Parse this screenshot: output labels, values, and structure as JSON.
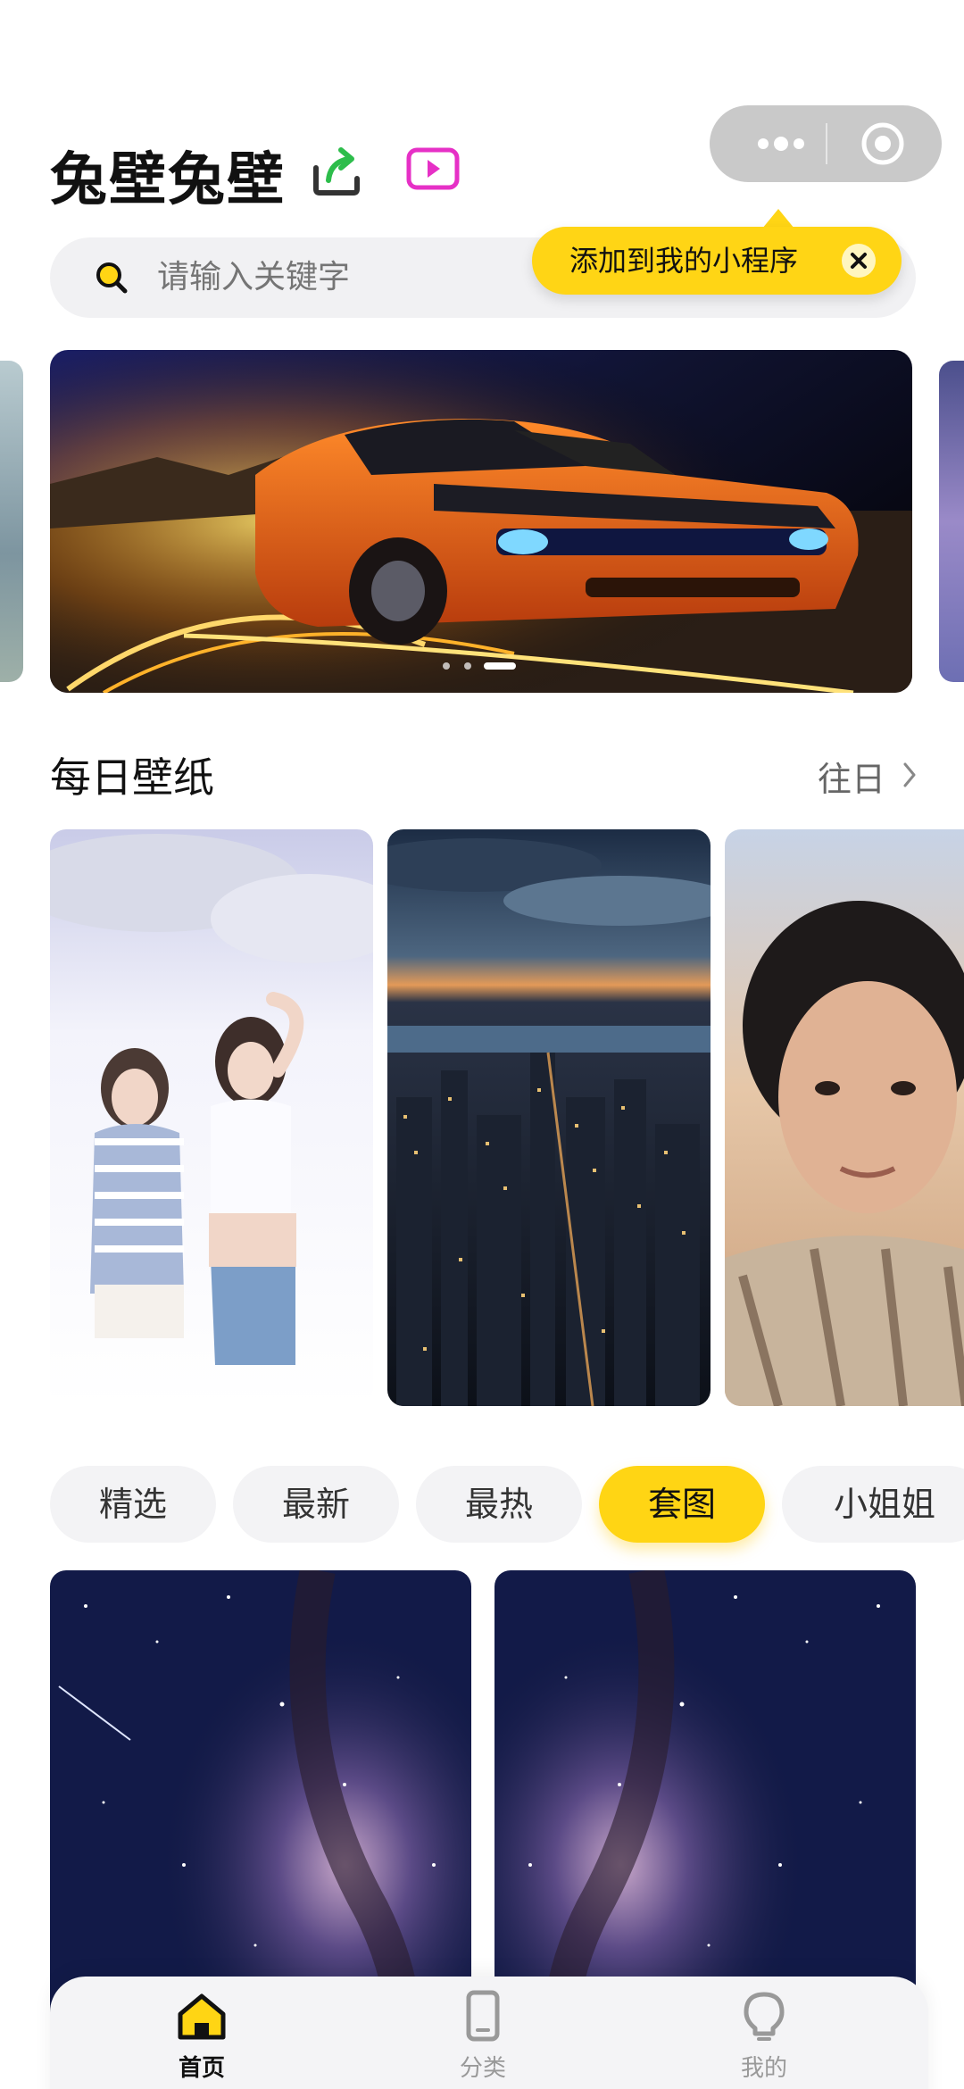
{
  "app": {
    "title": "兔壁兔壁"
  },
  "capsule": {
    "more_icon": "more-dots-icon",
    "close_icon": "target-icon"
  },
  "search": {
    "placeholder": "请输入关键字",
    "icon": "search-icon"
  },
  "tooltip": {
    "text": "添加到我的小程序",
    "close_icon": "close-icon"
  },
  "banner": {
    "slide_count": 3,
    "active_index": 2
  },
  "daily": {
    "title": "每日壁纸",
    "history_label": "往日"
  },
  "tabs": [
    {
      "label": "精选"
    },
    {
      "label": "最新"
    },
    {
      "label": "最热"
    },
    {
      "label": "套图"
    },
    {
      "label": "小姐姐"
    }
  ],
  "active_tab": 3,
  "nav": [
    {
      "label": "首页",
      "icon": "home-icon",
      "active": true
    },
    {
      "label": "分类",
      "icon": "phone-icon",
      "active": false
    },
    {
      "label": "我的",
      "icon": "bulb-icon",
      "active": false
    }
  ],
  "colors": {
    "accent": "#ffd514",
    "text": "#111111",
    "muted": "#999999"
  }
}
